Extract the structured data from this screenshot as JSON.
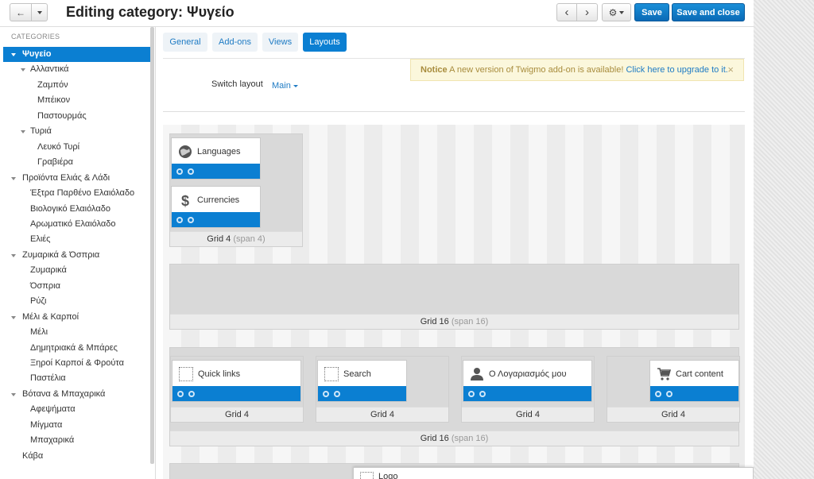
{
  "header": {
    "title": "Editing category: Ψυγείο",
    "back_label": "←",
    "prev_label": "‹",
    "next_label": "›",
    "gear_label": "⚙",
    "save_label": "Save",
    "save_close_label": "Save and close"
  },
  "sidebar": {
    "title": "CATEGORIES",
    "items": [
      {
        "label": "Ψυγείο",
        "level": 0,
        "caret": true,
        "active": true
      },
      {
        "label": "Αλλαντικά",
        "level": 1,
        "caret": true
      },
      {
        "label": "Ζαμπόν",
        "level": 2
      },
      {
        "label": "Μπέικον",
        "level": 2
      },
      {
        "label": "Παστουρμάς",
        "level": 2
      },
      {
        "label": "Τυριά",
        "level": 1,
        "caret": true
      },
      {
        "label": "Λευκό Τυρί",
        "level": 2
      },
      {
        "label": "Γραβιέρα",
        "level": 2
      },
      {
        "label": "Προϊόντα Ελιάς & Λάδι",
        "level": 0,
        "caret": true
      },
      {
        "label": "Έξτρα Παρθένο Ελαιόλαδο",
        "level": 1
      },
      {
        "label": "Βιολογικό Ελαιόλαδο",
        "level": 1
      },
      {
        "label": "Αρωματικό Ελαιόλαδο",
        "level": 1
      },
      {
        "label": "Ελιές",
        "level": 1
      },
      {
        "label": "Ζυμαρικά & Όσπρια",
        "level": 0,
        "caret": true
      },
      {
        "label": "Ζυμαρικά",
        "level": 1
      },
      {
        "label": "Όσπρια",
        "level": 1
      },
      {
        "label": "Ρύζι",
        "level": 1
      },
      {
        "label": "Μέλι & Καρποί",
        "level": 0,
        "caret": true
      },
      {
        "label": "Μέλι",
        "level": 1
      },
      {
        "label": "Δημητριακά & Μπάρες",
        "level": 1
      },
      {
        "label": "Ξηροί Καρποί & Φρούτα",
        "level": 1
      },
      {
        "label": "Παστέλια",
        "level": 1
      },
      {
        "label": "Βότανα & Μπαχαρικά",
        "level": 0,
        "caret": true
      },
      {
        "label": "Αφεψήματα",
        "level": 1
      },
      {
        "label": "Μίγματα",
        "level": 1
      },
      {
        "label": "Μπαχαρικά",
        "level": 1
      },
      {
        "label": "Κάβα",
        "level": 0
      }
    ]
  },
  "tabs": [
    {
      "label": "General"
    },
    {
      "label": "Add-ons"
    },
    {
      "label": "Views"
    },
    {
      "label": "Layouts",
      "active": true
    }
  ],
  "notice": {
    "title": "Notice",
    "text": "A new version of Twigmo add-on is available!",
    "link": "Click here to upgrade to it.",
    "close": "×"
  },
  "switch_layout": {
    "label": "Switch layout",
    "value": "Main"
  },
  "grids": {
    "g1": {
      "label": "Grid 4",
      "span": "(span 4)"
    },
    "g2": {
      "label": "Grid 16",
      "span": "(span 16)"
    },
    "g3": {
      "label": "Grid 4"
    },
    "g4": {
      "label": "Grid 4"
    },
    "g5": {
      "label": "Grid 4"
    },
    "g6": {
      "label": "Grid 4"
    },
    "g7": {
      "label": "Grid 16",
      "span": "(span 16)"
    }
  },
  "blocks": {
    "languages": "Languages",
    "currencies": "Currencies",
    "quick_links": "Quick links",
    "search": "Search",
    "account": "Ο Λογαριασμός μου",
    "cart": "Cart content",
    "logo": "Logo"
  },
  "colors": {
    "accent": "#0b7fd2",
    "notice_bg": "#fbf7dc"
  }
}
